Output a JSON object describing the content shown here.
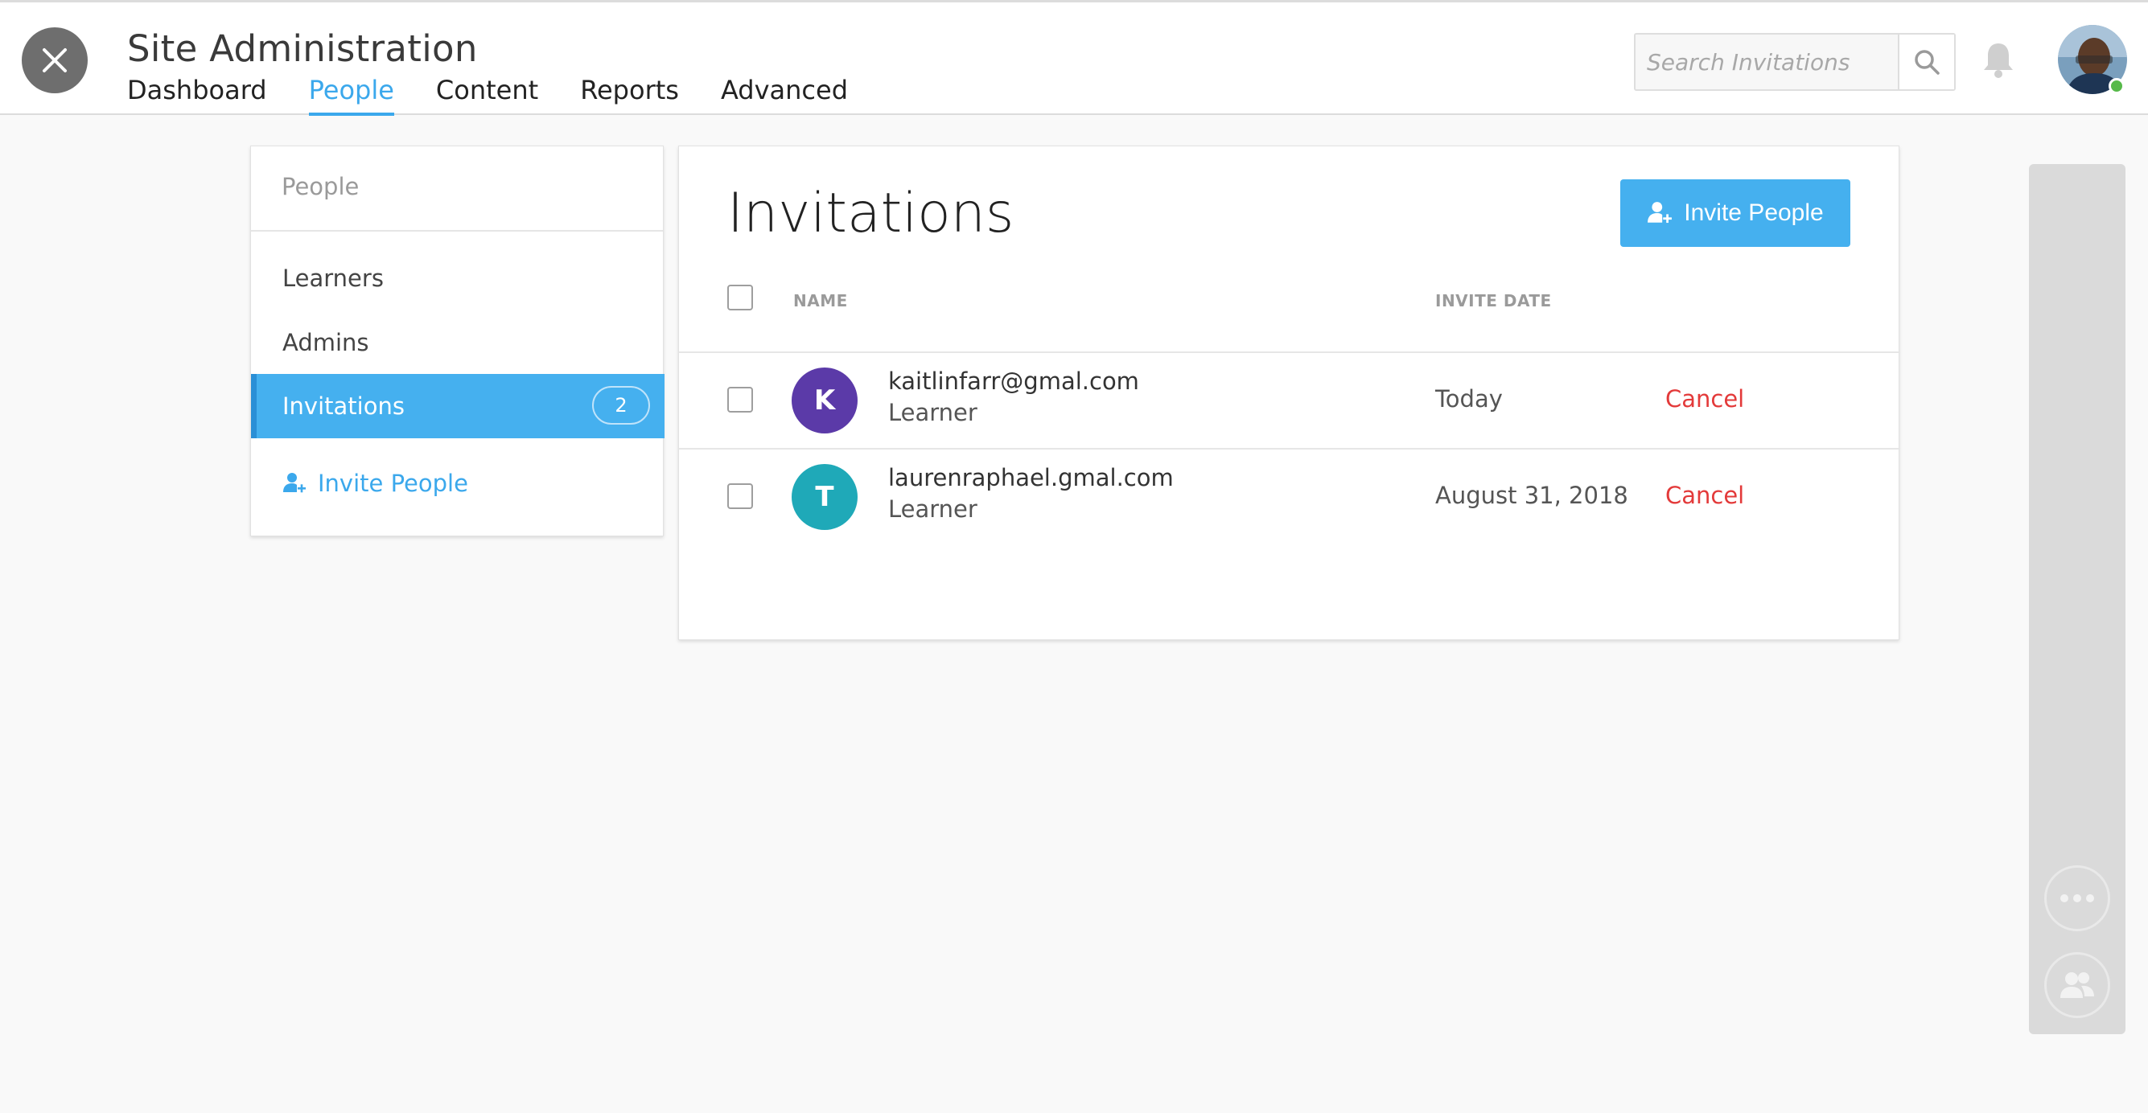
{
  "header": {
    "title": "Site Administration",
    "tabs": [
      {
        "label": "Dashboard",
        "active": false
      },
      {
        "label": "People",
        "active": true
      },
      {
        "label": "Content",
        "active": false
      },
      {
        "label": "Reports",
        "active": false
      },
      {
        "label": "Advanced",
        "active": false
      }
    ],
    "search": {
      "placeholder": "Search Invitations",
      "value": ""
    },
    "icons": {
      "close": "close-icon",
      "search": "search-icon",
      "notifications": "bell-icon",
      "user": "user-avatar"
    },
    "user_status_color": "#56b949"
  },
  "sidebar": {
    "header": "People",
    "items": [
      {
        "label": "Learners",
        "active": false
      },
      {
        "label": "Admins",
        "active": false
      },
      {
        "label": "Invitations",
        "active": true,
        "badge": "2"
      }
    ],
    "invite_link": "Invite People"
  },
  "main": {
    "title": "Invitations",
    "invite_button": "Invite People",
    "columns": {
      "name": "NAME",
      "invite_date": "INVITE DATE"
    },
    "rows": [
      {
        "initial": "K",
        "avatar_color": "#5b3aa8",
        "email": "kaitlinfarr@gmal.com",
        "role": "Learner",
        "date": "Today",
        "action": "Cancel"
      },
      {
        "initial": "T",
        "avatar_color": "#1fa9b8",
        "email": "laurenraphael.gmal.com",
        "role": "Learner",
        "date": "August 31, 2018",
        "action": "Cancel"
      }
    ]
  },
  "colors": {
    "accent": "#45b0ef",
    "danger": "#e33a3a",
    "active_tab": "#3ba8ec"
  }
}
